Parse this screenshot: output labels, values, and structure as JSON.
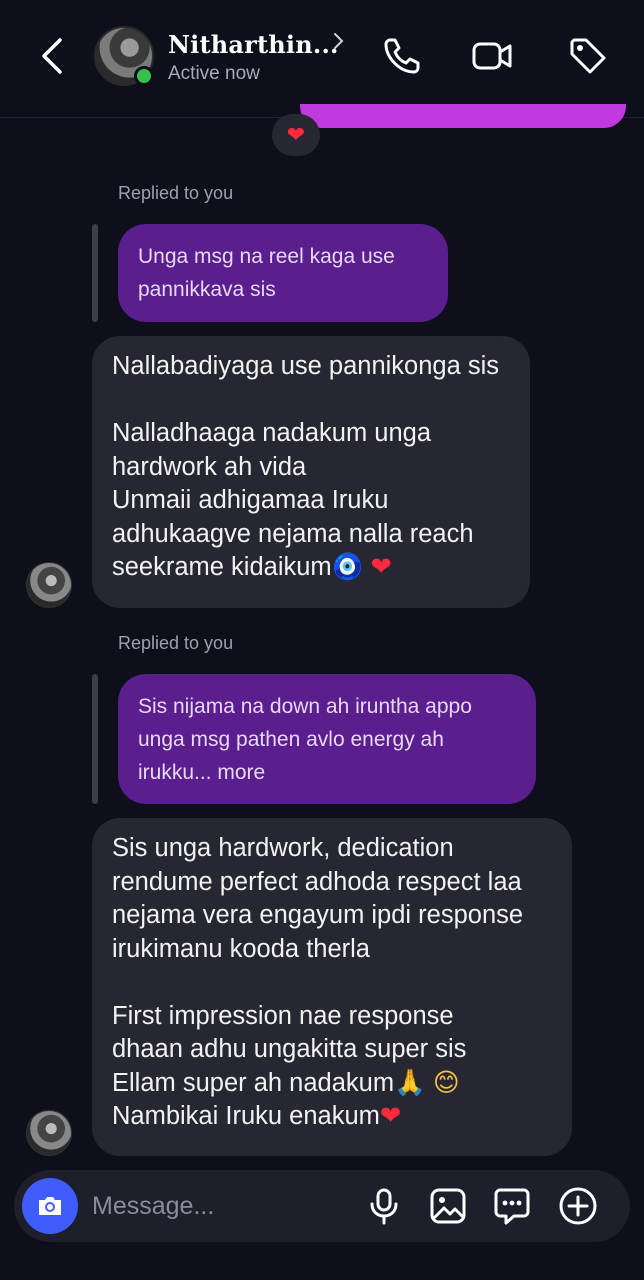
{
  "header": {
    "name": "Nitharthin...",
    "status": "Active now",
    "icons": [
      "back-icon",
      "phone-icon",
      "video-icon",
      "tag-icon"
    ]
  },
  "previous_message": {
    "reaction": "❤"
  },
  "thread": [
    {
      "replied_label": "Replied to you",
      "quoted": [
        "Unga msg na reel kaga use",
        "pannikkava sis"
      ],
      "reply_lines": [
        "Nallabadiyaga use pannikonga sis",
        "",
        "Nalladhaaga nadakum unga",
        "hardwork ah vida",
        "Unmaii adhigamaa Iruku",
        "adhukaagve nejama nalla reach",
        "seekrame kidaikum"
      ],
      "reply_emoji": [
        "🧿",
        "❤"
      ]
    },
    {
      "replied_label": "Replied to you",
      "quoted": [
        "Sis nijama na down ah iruntha appo",
        "unga msg pathen avlo energy ah",
        "irukku... more"
      ],
      "reply_lines": [
        "Sis unga hardwork, dedication",
        "rendume perfect adhoda respect laa",
        "nejama vera engayum ipdi response",
        "irukimanu kooda therla",
        "",
        "First impression nae response",
        "dhaan adhu ungakitta super sis",
        "Ellam super ah nadakum",
        "Nambikai Iruku enakum"
      ],
      "line8_emoji": [
        "🙏",
        "😊"
      ],
      "line9_emoji": [
        "❤"
      ]
    }
  ],
  "composer": {
    "placeholder": "Message...",
    "icons": [
      "camera-icon",
      "microphone-icon",
      "gallery-icon",
      "sticker-icon",
      "add-icon"
    ]
  },
  "colors": {
    "background": "#0d0f1a",
    "incoming_bubble": "#262730",
    "quoted_bubble": "#5a1e8f",
    "sent_bubble": "#c03ae0",
    "camera_button": "#3f5dff",
    "online": "#36c24a"
  }
}
